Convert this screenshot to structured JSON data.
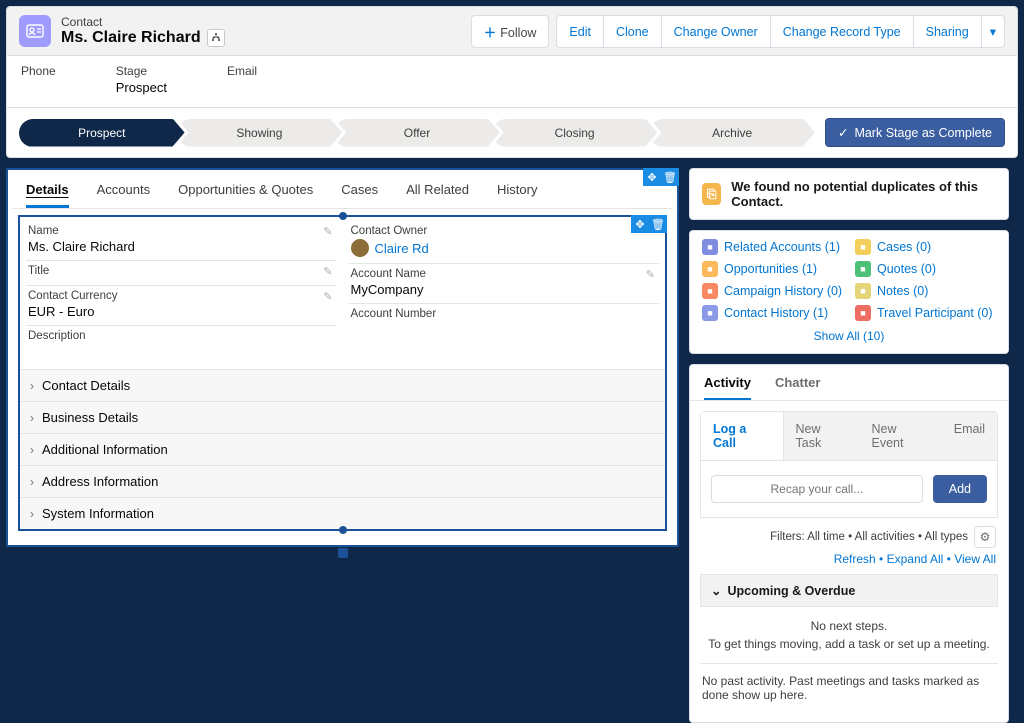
{
  "record": {
    "type_label": "Contact",
    "name": "Ms. Claire Richard"
  },
  "header_actions": {
    "follow": "Follow",
    "edit": "Edit",
    "clone": "Clone",
    "change_owner": "Change Owner",
    "change_record_type": "Change Record Type",
    "sharing": "Sharing"
  },
  "highlights": {
    "phone_label": "Phone",
    "phone_value": "",
    "stage_label": "Stage",
    "stage_value": "Prospect",
    "email_label": "Email",
    "email_value": ""
  },
  "path": {
    "stages": [
      "Prospect",
      "Showing",
      "Offer",
      "Closing",
      "Archive"
    ],
    "complete_label": "Mark Stage as Complete"
  },
  "tabs": [
    "Details",
    "Accounts",
    "Opportunities & Quotes",
    "Cases",
    "All Related",
    "History"
  ],
  "details": {
    "left": {
      "name_label": "Name",
      "name_value": "Ms. Claire Richard",
      "title_label": "Title",
      "title_value": "",
      "currency_label": "Contact Currency",
      "currency_value": "EUR - Euro",
      "description_label": "Description"
    },
    "right": {
      "owner_label": "Contact Owner",
      "owner_value": "Claire Rd",
      "account_label": "Account Name",
      "account_value": "MyCompany",
      "acct_num_label": "Account Number"
    },
    "sections": [
      "Contact Details",
      "Business Details",
      "Additional Information",
      "Address Information",
      "System Information"
    ]
  },
  "dup_banner": "We found no potential duplicates of this Contact.",
  "related": [
    {
      "label": "Related Accounts (1)",
      "color": "#7f8de1"
    },
    {
      "label": "Cases (0)",
      "color": "#f2cf5b"
    },
    {
      "label": "Opportunities (1)",
      "color": "#fcb95b"
    },
    {
      "label": "Quotes (0)",
      "color": "#4bc076"
    },
    {
      "label": "Campaign History (0)",
      "color": "#f88962"
    },
    {
      "label": "Notes (0)",
      "color": "#e6d478"
    },
    {
      "label": "Contact History (1)",
      "color": "#8a9ae6"
    },
    {
      "label": "Travel Participant (0)",
      "color": "#ef6e64"
    }
  ],
  "show_all": "Show All (10)",
  "activity": {
    "tabs": [
      "Activity",
      "Chatter"
    ],
    "sub_tabs": [
      "Log a Call",
      "New Task",
      "New Event",
      "Email"
    ],
    "recap_placeholder": "Recap your call...",
    "add_label": "Add",
    "filters_line": "Filters: All time • All activities • All types",
    "refresh": "Refresh",
    "expand": "Expand All",
    "view_all": "View All",
    "upcoming_header": "Upcoming & Overdue",
    "no_steps_1": "No next steps.",
    "no_steps_2": "To get things moving, add a task or set up a meeting.",
    "no_past": "No past activity. Past meetings and tasks marked as done show up here."
  }
}
